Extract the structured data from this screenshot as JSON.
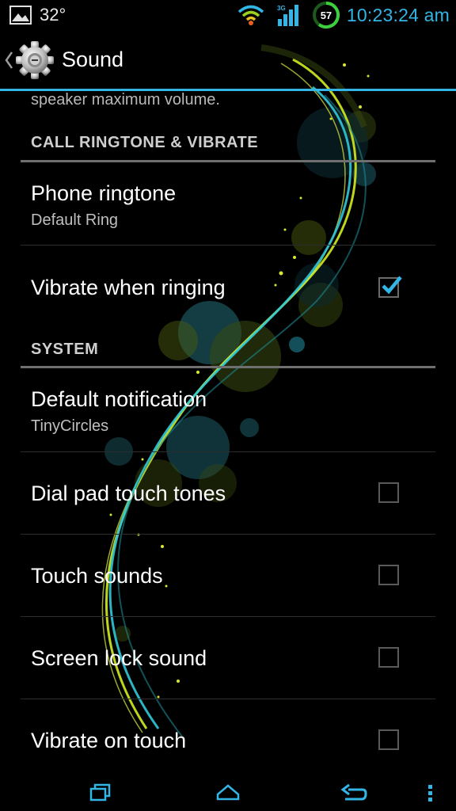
{
  "status_bar": {
    "temperature": "32°",
    "battery_level": "57",
    "time": "10:23:24 am",
    "icons": [
      "image-icon",
      "wifi-icon",
      "signal-icon",
      "battery-icon"
    ]
  },
  "action_bar": {
    "title": "Sound",
    "icons": [
      "up-caret-icon",
      "settings-gear-icon"
    ]
  },
  "list": {
    "fragment_text": "speaker maximum volume.",
    "section_call": "CALL RINGTONE & VIBRATE",
    "phone_ringtone": {
      "title": "Phone ringtone",
      "summary": "Default Ring"
    },
    "vibrate_when_ringing": {
      "title": "Vibrate when ringing",
      "checked": true
    },
    "section_system": "SYSTEM",
    "default_notification": {
      "title": "Default notification",
      "summary": "TinyCircles"
    },
    "dial_pad_touch_tones": {
      "title": "Dial pad touch tones",
      "checked": false
    },
    "touch_sounds": {
      "title": "Touch sounds",
      "checked": false
    },
    "screen_lock_sound": {
      "title": "Screen lock sound",
      "checked": false
    },
    "vibrate_on_touch": {
      "title": "Vibrate on touch",
      "checked": false
    }
  },
  "nav_bar": {
    "icons": [
      "recent-apps-icon",
      "home-icon",
      "back-icon",
      "menu-icon"
    ]
  },
  "colors": {
    "accent": "#33b5e5",
    "background": "#000000",
    "section_line": "#6f6f6f"
  }
}
